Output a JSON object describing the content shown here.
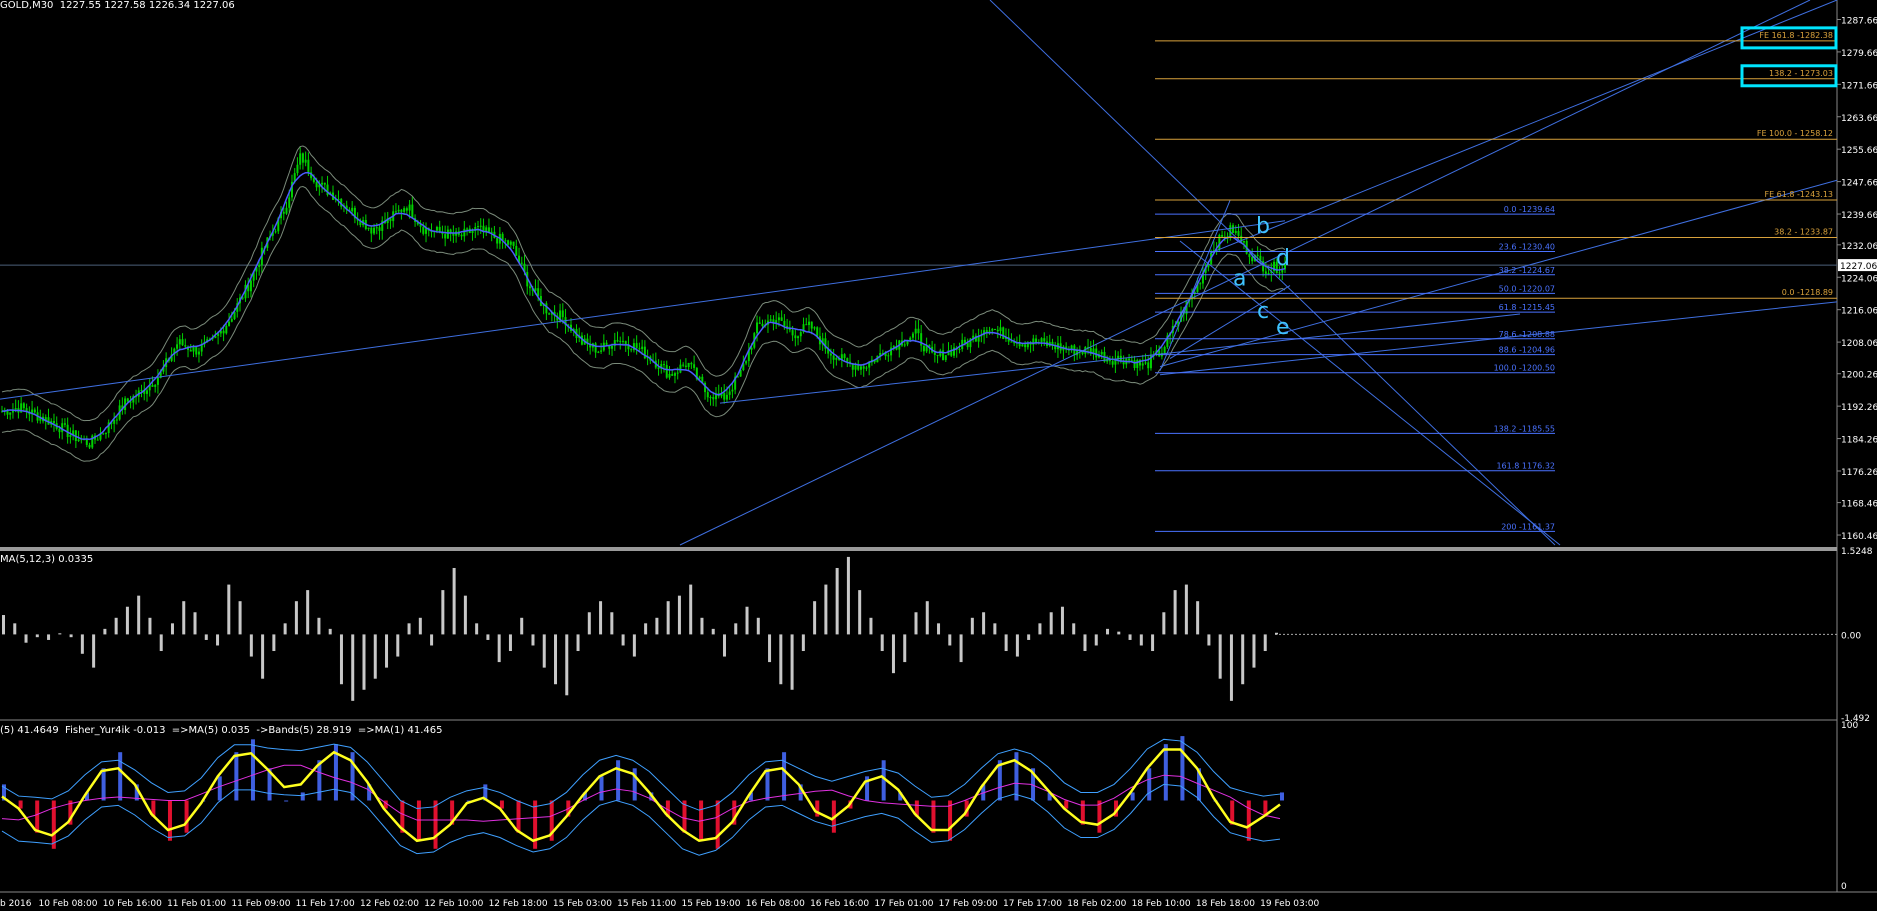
{
  "header": {
    "main_title": "GOLD,M30  1227.55 1227.58 1226.34 1227.06",
    "osma_title": "MA(5,12,3) 0.0335",
    "fisher_title": "(5) 41.4649  Fisher_Yur4ik -0.013  =>MA(5) 0.035  ->Bands(5) 28.919  =>MA(1) 41.465"
  },
  "colors": {
    "background": "#000000",
    "candle": "#00d200",
    "trendline": "#3f6fe0",
    "fibo_retrace": "#4a72ff",
    "fibo_expansion": "#d9a23c",
    "wave_label": "#3fc3ff",
    "highlight_box": "#00e5ff",
    "osma_bar": "#c8c8c8",
    "fisher_pos": "#3f5fe0",
    "fisher_neg": "#e0102e",
    "fisher_line": "#ffff1e",
    "fisher_band": "#3fa0ff",
    "fisher_ma": "#e030e0",
    "axis_text": "#ffffff"
  },
  "chart_data": [
    {
      "type": "candlestick",
      "title": "GOLD,M30",
      "current_price": "1227.06",
      "y_ticks": [
        "1287.66",
        "1279.66",
        "1271.66",
        "1263.66",
        "1255.66",
        "1247.66",
        "1239.66",
        "1232.06",
        "1224.06",
        "1216.06",
        "1208.06",
        "1200.26",
        "1192.26",
        "1184.26",
        "1176.26",
        "1168.46",
        "1160.46"
      ],
      "x_ticks": [
        "b 2016",
        "10 Feb 08:00",
        "10 Feb 16:00",
        "11 Feb 01:00",
        "11 Feb 09:00",
        "11 Feb 17:00",
        "12 Feb 02:00",
        "12 Feb 10:00",
        "12 Feb 18:00",
        "15 Feb 03:00",
        "15 Feb 11:00",
        "15 Feb 19:00",
        "16 Feb 08:00",
        "16 Feb 16:00",
        "17 Feb 01:00",
        "17 Feb 09:00",
        "17 Feb 17:00",
        "18 Feb 02:00",
        "18 Feb 10:00",
        "18 Feb 18:00",
        "19 Feb 03:00"
      ],
      "close_path": [
        1191,
        1192,
        1190,
        1188,
        1185,
        1183,
        1187,
        1193,
        1196,
        1200,
        1208,
        1206,
        1208,
        1214,
        1222,
        1232,
        1240,
        1254,
        1247,
        1244,
        1240,
        1236,
        1238,
        1242,
        1236,
        1235,
        1234,
        1236,
        1234,
        1232,
        1222,
        1216,
        1214,
        1208,
        1206,
        1209,
        1207,
        1204,
        1200,
        1203,
        1196,
        1194,
        1200,
        1212,
        1214,
        1210,
        1212,
        1206,
        1203,
        1202,
        1205,
        1208,
        1210,
        1204,
        1206,
        1208,
        1212,
        1210,
        1208,
        1208,
        1207,
        1206,
        1206,
        1204,
        1204,
        1202,
        1206,
        1214,
        1222,
        1232,
        1236,
        1230,
        1226,
        1227
      ],
      "fibo_retracement": [
        {
          "label": "0.0 -1239.64",
          "price": 1239.64
        },
        {
          "label": "23.6 -1230.40",
          "price": 1230.4
        },
        {
          "label": "38.2 -1224.67",
          "price": 1224.67
        },
        {
          "label": "50.0 -1220.07",
          "price": 1220.07
        },
        {
          "label": "61.8 -1215.45",
          "price": 1215.45
        },
        {
          "label": "78.6 -1208.88",
          "price": 1208.88
        },
        {
          "label": "88.6 -1204.96",
          "price": 1204.96
        },
        {
          "label": "100.0 -1200.50",
          "price": 1200.5
        },
        {
          "label": "138.2  -1185.55",
          "price": 1185.55
        },
        {
          "label": "161.8 1176.32",
          "price": 1176.32
        },
        {
          "label": "200 -1161.37",
          "price": 1161.37
        }
      ],
      "fibo_expansion": [
        {
          "label": "FE 161.8 -1282.38",
          "price": 1282.38,
          "boxed": true
        },
        {
          "label": "138.2 - 1273.03",
          "price": 1273.03,
          "boxed": true
        },
        {
          "label": "FE 100.0 - 1258.12",
          "price": 1258.12,
          "boxed": false
        },
        {
          "label": "FE 61.8 -1243.13",
          "price": 1243.13,
          "boxed": false
        },
        {
          "label": "38.2 - 1233.87",
          "price": 1233.87,
          "boxed": false
        },
        {
          "label": "0.0 -1218.89",
          "price": 1218.89,
          "boxed": false
        }
      ],
      "wave_labels": [
        "a",
        "b",
        "c",
        "d",
        "e"
      ]
    },
    {
      "type": "bar",
      "title": "MA(5,12,3) 0.0335",
      "ylim": [
        -1.492,
        1.5248
      ],
      "y_ticks": [
        "1.5248",
        "0.00",
        "-1.492"
      ],
      "values": [
        0.35,
        0.2,
        -0.15,
        -0.05,
        -0.1,
        0.02,
        -0.05,
        -0.35,
        -0.6,
        0.1,
        0.3,
        0.5,
        0.7,
        0.3,
        -0.3,
        0.2,
        0.6,
        0.4,
        -0.1,
        -0.2,
        0.9,
        0.6,
        -0.4,
        -0.8,
        -0.3,
        0.2,
        0.6,
        0.8,
        0.3,
        0.1,
        -0.9,
        -1.2,
        -1.0,
        -0.8,
        -0.6,
        -0.4,
        0.2,
        0.3,
        -0.2,
        0.8,
        1.2,
        0.7,
        0.2,
        -0.1,
        -0.5,
        -0.3,
        0.3,
        -0.2,
        -0.6,
        -0.9,
        -1.1,
        -0.3,
        0.4,
        0.6,
        0.4,
        -0.2,
        -0.4,
        0.2,
        0.3,
        0.6,
        0.7,
        0.9,
        0.3,
        0.1,
        -0.4,
        0.2,
        0.5,
        0.3,
        -0.5,
        -0.9,
        -1.0,
        -0.3,
        0.6,
        0.9,
        1.2,
        1.4,
        0.8,
        0.3,
        -0.3,
        -0.7,
        -0.5,
        0.4,
        0.6,
        0.2,
        -0.2,
        -0.5,
        0.3,
        0.4,
        0.2,
        -0.3,
        -0.4,
        -0.1,
        0.2,
        0.4,
        0.5,
        0.2,
        -0.3,
        -0.2,
        0.1,
        0.05,
        -0.1,
        -0.2,
        -0.3,
        0.4,
        0.8,
        0.9,
        0.6,
        -0.2,
        -0.8,
        -1.2,
        -0.9,
        -0.6,
        -0.3,
        0.03
      ]
    },
    {
      "type": "bar",
      "title": "Fisher_Yur4ik",
      "ylim": [
        0,
        100
      ],
      "y_ticks": [
        "100",
        "0"
      ],
      "values": [
        60,
        45,
        30,
        20,
        35,
        55,
        70,
        80,
        60,
        40,
        25,
        30,
        50,
        65,
        80,
        88,
        70,
        50,
        55,
        75,
        85,
        80,
        60,
        45,
        30,
        25,
        20,
        35,
        50,
        60,
        45,
        30,
        20,
        25,
        40,
        55,
        65,
        75,
        70,
        55,
        40,
        30,
        25,
        20,
        35,
        55,
        70,
        80,
        60,
        40,
        30,
        45,
        65,
        75,
        55,
        40,
        30,
        25,
        40,
        60,
        75,
        80,
        70,
        55,
        45,
        35,
        30,
        40,
        55,
        70,
        85,
        90,
        70,
        50,
        35,
        25,
        40,
        55
      ]
    }
  ]
}
